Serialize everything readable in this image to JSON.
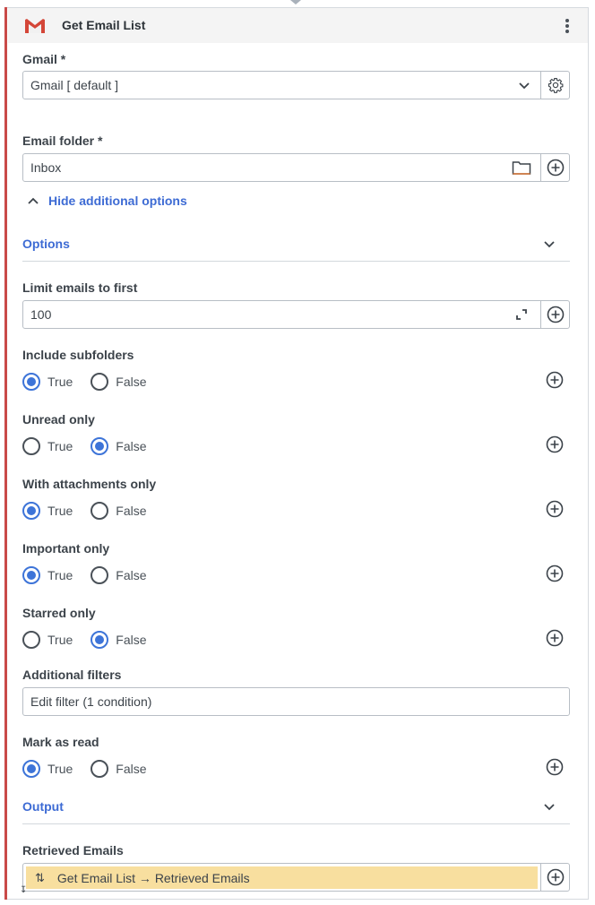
{
  "header": {
    "title": "Get Email List",
    "logo_icon": "gmail-logo-icon",
    "menu_icon": "kebab-menu-icon"
  },
  "gmail": {
    "label": "Gmail *",
    "value": "Gmail [ default ]",
    "dropdown_icon": "chevron-down-icon",
    "settings_icon": "gear-icon"
  },
  "email_folder": {
    "label": "Email folder *",
    "value": "Inbox",
    "folder_icon": "folder-icon",
    "add_icon": "plus-circle-icon"
  },
  "toggle_options": {
    "label": "Hide additional options",
    "icon": "chevron-up-icon"
  },
  "options_section": {
    "title": "Options",
    "icon": "chevron-down-icon"
  },
  "limit": {
    "label": "Limit emails to first",
    "value": "100",
    "expand_icon": "expand-icon",
    "add_icon": "plus-circle-icon"
  },
  "radio_groups": [
    {
      "label": "Include subfolders",
      "options": [
        "True",
        "False"
      ],
      "selected": "True"
    },
    {
      "label": "Unread only",
      "options": [
        "True",
        "False"
      ],
      "selected": "False"
    },
    {
      "label": "With attachments only",
      "options": [
        "True",
        "False"
      ],
      "selected": "True"
    },
    {
      "label": "Important only",
      "options": [
        "True",
        "False"
      ],
      "selected": "True"
    },
    {
      "label": "Starred only",
      "options": [
        "True",
        "False"
      ],
      "selected": "False"
    }
  ],
  "additional_filters": {
    "label": "Additional filters",
    "value": "Edit filter (1 condition)"
  },
  "mark_as_read": {
    "label": "Mark as read",
    "options": [
      "True",
      "False"
    ],
    "selected": "True"
  },
  "output_section": {
    "title": "Output",
    "icon": "chevron-down-icon"
  },
  "retrieved_emails": {
    "label": "Retrieved Emails",
    "value": "Get Email List → Retrieved Emails",
    "arrows_icon": "swap-vertical-icon",
    "add_icon": "plus-circle-icon"
  },
  "colors": {
    "accent": "#3d6bd4",
    "radio_selected": "#3d74d8",
    "error_bar": "#c94a48",
    "output_chip": "#f8df9f"
  }
}
